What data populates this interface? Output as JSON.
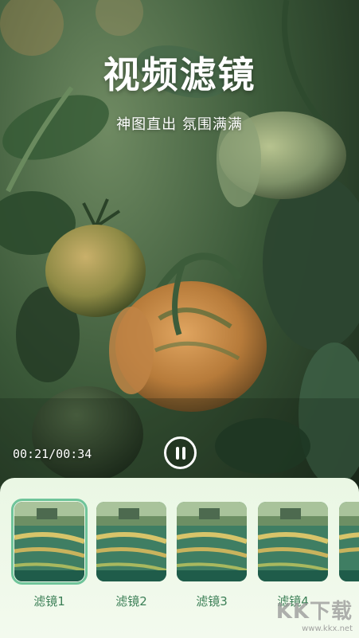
{
  "hero": {
    "title": "视频滤镜",
    "subtitle": "神图直出  氛围满满"
  },
  "player": {
    "time": "00:21/00:34",
    "state_icon": "pause-icon"
  },
  "filters": [
    {
      "label": "滤镜1",
      "selected": true
    },
    {
      "label": "滤镜2",
      "selected": false
    },
    {
      "label": "滤镜3",
      "selected": false
    },
    {
      "label": "滤镜4",
      "selected": false
    },
    {
      "label": "",
      "selected": false
    }
  ],
  "watermark": {
    "mark": "KK下载",
    "url": "www.kkx.net"
  },
  "colors": {
    "accent": "#6fc49a",
    "label": "#3b7f56",
    "panel": "#eaf7e4"
  }
}
